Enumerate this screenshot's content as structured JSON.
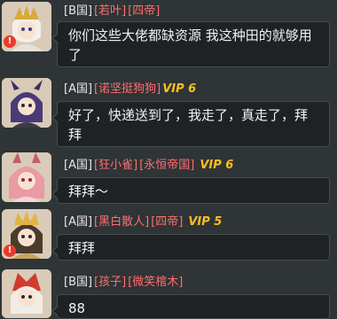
{
  "messages": [
    {
      "server": "[B国]",
      "nick": "[若叶]",
      "alliance": "[四帝]",
      "vip": "",
      "text": "你们这些大佬都缺资源 我这种田的就够用了",
      "avatar_icon": "white-hair-gold-helmet-avatar-icon",
      "has_warning": true
    },
    {
      "server": "[A国]",
      "nick": "[诺坚挺狗狗]",
      "alliance": "",
      "vip": "VIP 6",
      "text": "好了，快递送到了，我走了，真走了，拜拜",
      "avatar_icon": "purple-hair-horned-avatar-icon",
      "has_warning": false
    },
    {
      "server": "[A国]",
      "nick": "[狂小雀]",
      "alliance": "[永恒帝国]",
      "vip": "VIP 6",
      "text": "拜拜～",
      "avatar_icon": "pink-hair-avatar-icon",
      "has_warning": false
    },
    {
      "server": "[A国]",
      "nick": "[黑白散人]",
      "alliance": "[四帝]",
      "vip": "VIP 5",
      "text": "拜拜",
      "avatar_icon": "gold-crown-avatar-icon",
      "has_warning": true
    },
    {
      "server": "[B国]",
      "nick": "[孩子]",
      "alliance": "[微笑棺木]",
      "vip": "",
      "text": "88",
      "avatar_icon": "red-armor-avatar-icon",
      "has_warning": false
    }
  ],
  "colors": {
    "background": "#2f3436",
    "nick": "#ff6e6e",
    "vip": "#ffbe1f",
    "bubble": "#1f2224"
  }
}
